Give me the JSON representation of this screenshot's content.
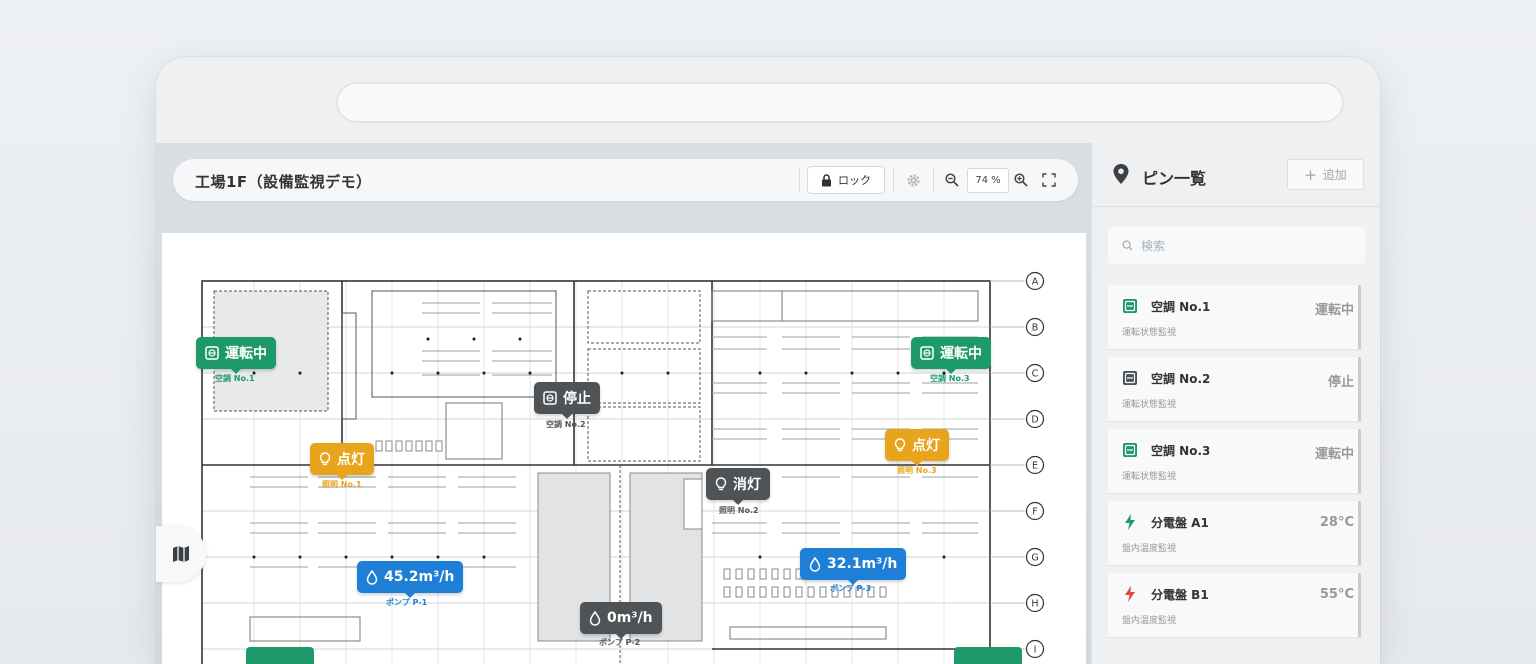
{
  "map": {
    "title": "工場1F（設備監視デモ）",
    "lock_label": "ロック",
    "zoom_value": "74",
    "zoom_unit": "%",
    "row_labels": [
      "A",
      "B",
      "C",
      "D",
      "E",
      "F",
      "G",
      "H",
      "I"
    ],
    "markers": {
      "ac1": {
        "text": "運転中",
        "label": "空調 No.1"
      },
      "ac2": {
        "text": "停止",
        "label": "空調 No.2"
      },
      "ac3": {
        "text": "運転中",
        "label": "空調 No.3"
      },
      "light1": {
        "text": "点灯",
        "label": "照明 No.1"
      },
      "light2": {
        "text": "消灯",
        "label": "照明 No.2"
      },
      "light3": {
        "text": "点灯",
        "label": "照明 No.3"
      },
      "pump1": {
        "text": "45.2m³/h",
        "label": "ポンプ P-1"
      },
      "pump2": {
        "text": "0m³/h",
        "label": "ポンプ P-2"
      },
      "pump3": {
        "text": "32.1m³/h",
        "label": "ポンプ P-3"
      }
    }
  },
  "sidebar": {
    "title": "ピン一覧",
    "add_label": "追加",
    "search_placeholder": "検索",
    "pins": [
      {
        "name": "空調 No.1",
        "sub": "運転状態監視",
        "value": "運転中",
        "icon": "ac-icon"
      },
      {
        "name": "空調 No.2",
        "sub": "運転状態監視",
        "value": "停止",
        "icon": "ac-icon"
      },
      {
        "name": "空調 No.3",
        "sub": "運転状態監視",
        "value": "運転中",
        "icon": "ac-icon"
      },
      {
        "name": "分電盤 A1",
        "sub": "盤内温度監視",
        "value": "28°C",
        "icon": "bolt-icon"
      },
      {
        "name": "分電盤 B1",
        "sub": "盤内温度監視",
        "value": "55°C",
        "icon": "bolt-icon"
      }
    ]
  },
  "colors": {
    "running": "#1e9a6a",
    "stopped": "#4f5356",
    "light_on": "#e8a41a",
    "pump": "#1d7fd6",
    "alert": "#e0463a"
  }
}
